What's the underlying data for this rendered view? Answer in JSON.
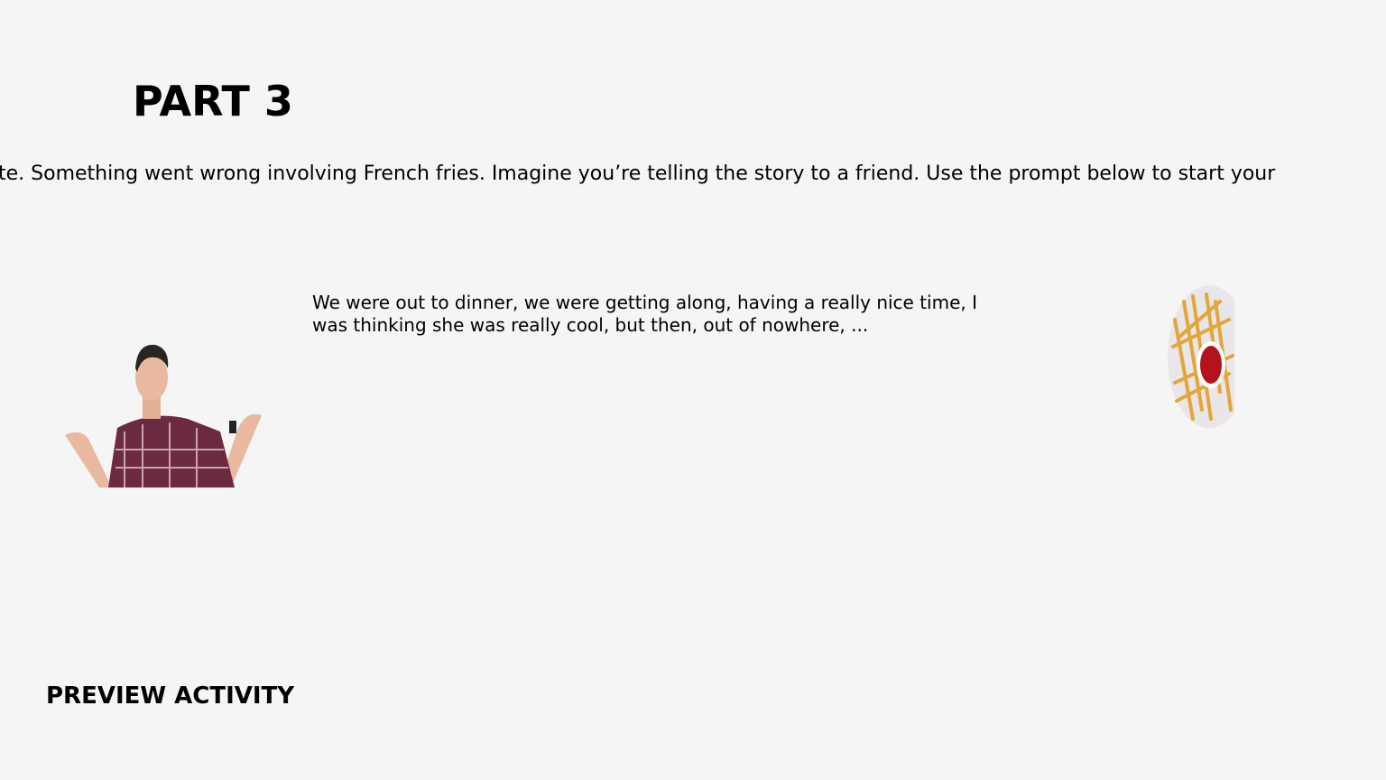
{
  "slide": {
    "title": "PART 3",
    "instruction": "te. Something went wrong involving French fries. Imagine you’re telling the story to a friend. Use the prompt below to start your",
    "prompt": "We were out to dinner, we were getting along, having a really nice time, I was thinking she was really cool, but then, out of nowhere, ...",
    "images": {
      "left": "shrugging-man-image",
      "right": "french-fries-image"
    }
  },
  "footer": {
    "preview_label": "PREVIEW ACTIVITY"
  }
}
